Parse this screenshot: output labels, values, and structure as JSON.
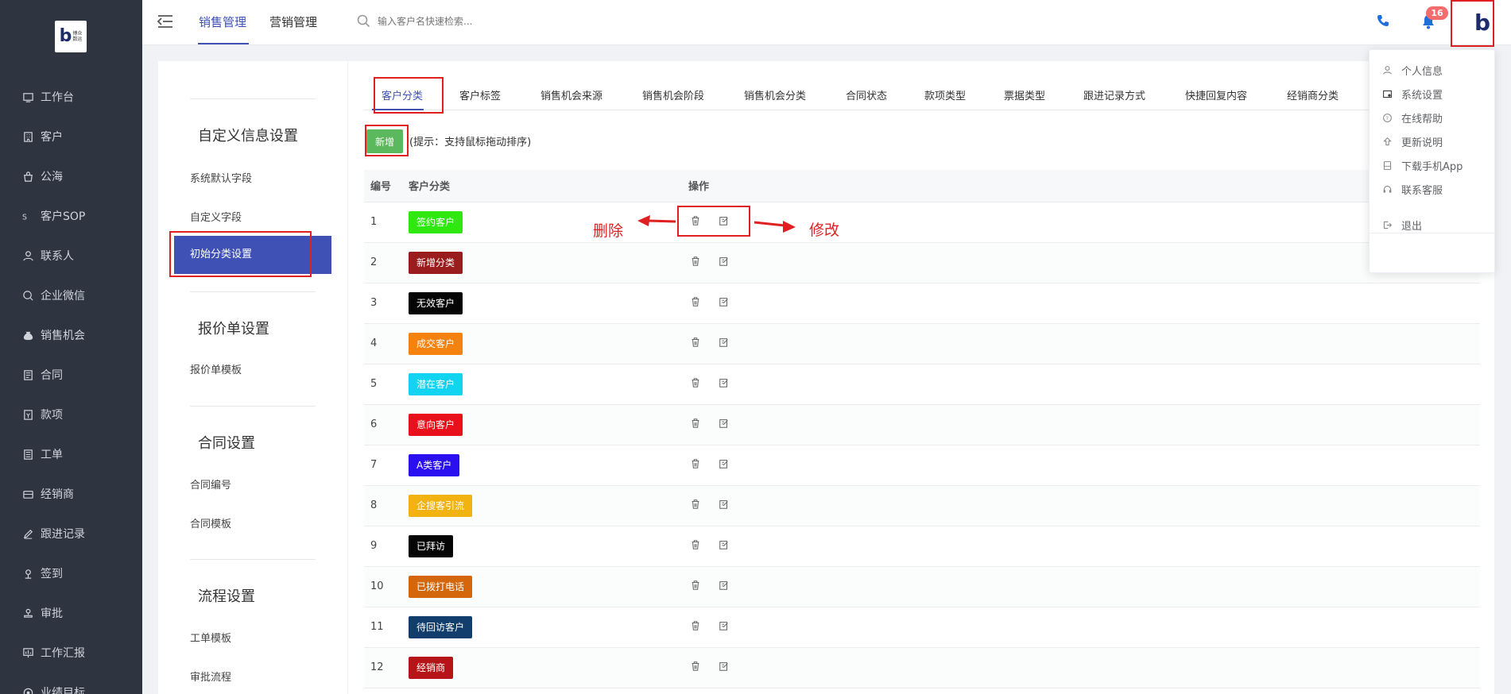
{
  "sidebar": {
    "logo_text": "博众\n数运",
    "items": [
      {
        "label": "工作台",
        "icon": "desk-icon"
      },
      {
        "label": "客户",
        "icon": "building-icon"
      },
      {
        "label": "公海",
        "icon": "bag-icon"
      },
      {
        "label": "客户SOP",
        "icon": "sop-icon"
      },
      {
        "label": "联系人",
        "icon": "user-icon"
      },
      {
        "label": "企业微信",
        "icon": "chat-icon"
      },
      {
        "label": "销售机会",
        "icon": "money-bag-icon"
      },
      {
        "label": "合同",
        "icon": "contract-icon"
      },
      {
        "label": "款项",
        "icon": "payment-icon"
      },
      {
        "label": "工单",
        "icon": "ticket-icon"
      },
      {
        "label": "经销商",
        "icon": "store-icon"
      },
      {
        "label": "跟进记录",
        "icon": "edit-icon"
      },
      {
        "label": "签到",
        "icon": "location-icon"
      },
      {
        "label": "审批",
        "icon": "stamp-icon"
      },
      {
        "label": "工作汇报",
        "icon": "report-icon"
      },
      {
        "label": "业绩目标",
        "icon": "target-icon"
      }
    ]
  },
  "topbar": {
    "tabs": [
      "销售管理",
      "营销管理"
    ],
    "search_placeholder": "输入客户名快速检索...",
    "notification_count": "16"
  },
  "settings": {
    "sections": [
      {
        "title": "自定义信息设置",
        "items": [
          "系统默认字段",
          "自定义字段",
          "初始分类设置"
        ]
      },
      {
        "title": "报价单设置",
        "items": [
          "报价单模板"
        ]
      },
      {
        "title": "合同设置",
        "items": [
          "合同编号",
          "合同模板"
        ]
      },
      {
        "title": "流程设置",
        "items": [
          "工单模板",
          "审批流程"
        ]
      }
    ]
  },
  "main": {
    "tabs": [
      "客户分类",
      "客户标签",
      "销售机会来源",
      "销售机会阶段",
      "销售机会分类",
      "合同状态",
      "款项类型",
      "票据类型",
      "跟进记录方式",
      "快捷回复内容",
      "经销商分类"
    ],
    "add_button": "新增",
    "hint": "(提示：支持鼠标拖动排序)",
    "columns": [
      "编号",
      "客户分类",
      "操作"
    ],
    "rows": [
      {
        "no": "1",
        "name": "签约客户",
        "color": "#2ee80f"
      },
      {
        "no": "2",
        "name": "新增分类",
        "color": "#9b1c1c"
      },
      {
        "no": "3",
        "name": "无效客户",
        "color": "#050505"
      },
      {
        "no": "4",
        "name": "成交客户",
        "color": "#f5820f"
      },
      {
        "no": "5",
        "name": "潜在客户",
        "color": "#12d3f0"
      },
      {
        "no": "6",
        "name": "意向客户",
        "color": "#e8101a"
      },
      {
        "no": "7",
        "name": "A类客户",
        "color": "#2a0ff0"
      },
      {
        "no": "8",
        "name": "企搜客引流",
        "color": "#f2b20f"
      },
      {
        "no": "9",
        "name": "已拜访",
        "color": "#050505"
      },
      {
        "no": "10",
        "name": "已拨打电话",
        "color": "#d4670c"
      },
      {
        "no": "11",
        "name": "待回访客户",
        "color": "#123e6e"
      },
      {
        "no": "12",
        "name": "经销商",
        "color": "#b71419"
      }
    ]
  },
  "annotations": {
    "delete": "删除",
    "edit": "修改"
  },
  "dropdown": {
    "items": [
      {
        "label": "个人信息",
        "icon": "person-icon"
      },
      {
        "label": "系统设置",
        "icon": "settings-icon"
      },
      {
        "label": "在线帮助",
        "icon": "help-icon"
      },
      {
        "label": "更新说明",
        "icon": "upload-icon"
      },
      {
        "label": "下载手机App",
        "icon": "phone-app-icon"
      },
      {
        "label": "联系客服",
        "icon": "headset-icon"
      },
      {
        "label": "退出",
        "icon": "logout-icon"
      }
    ]
  }
}
